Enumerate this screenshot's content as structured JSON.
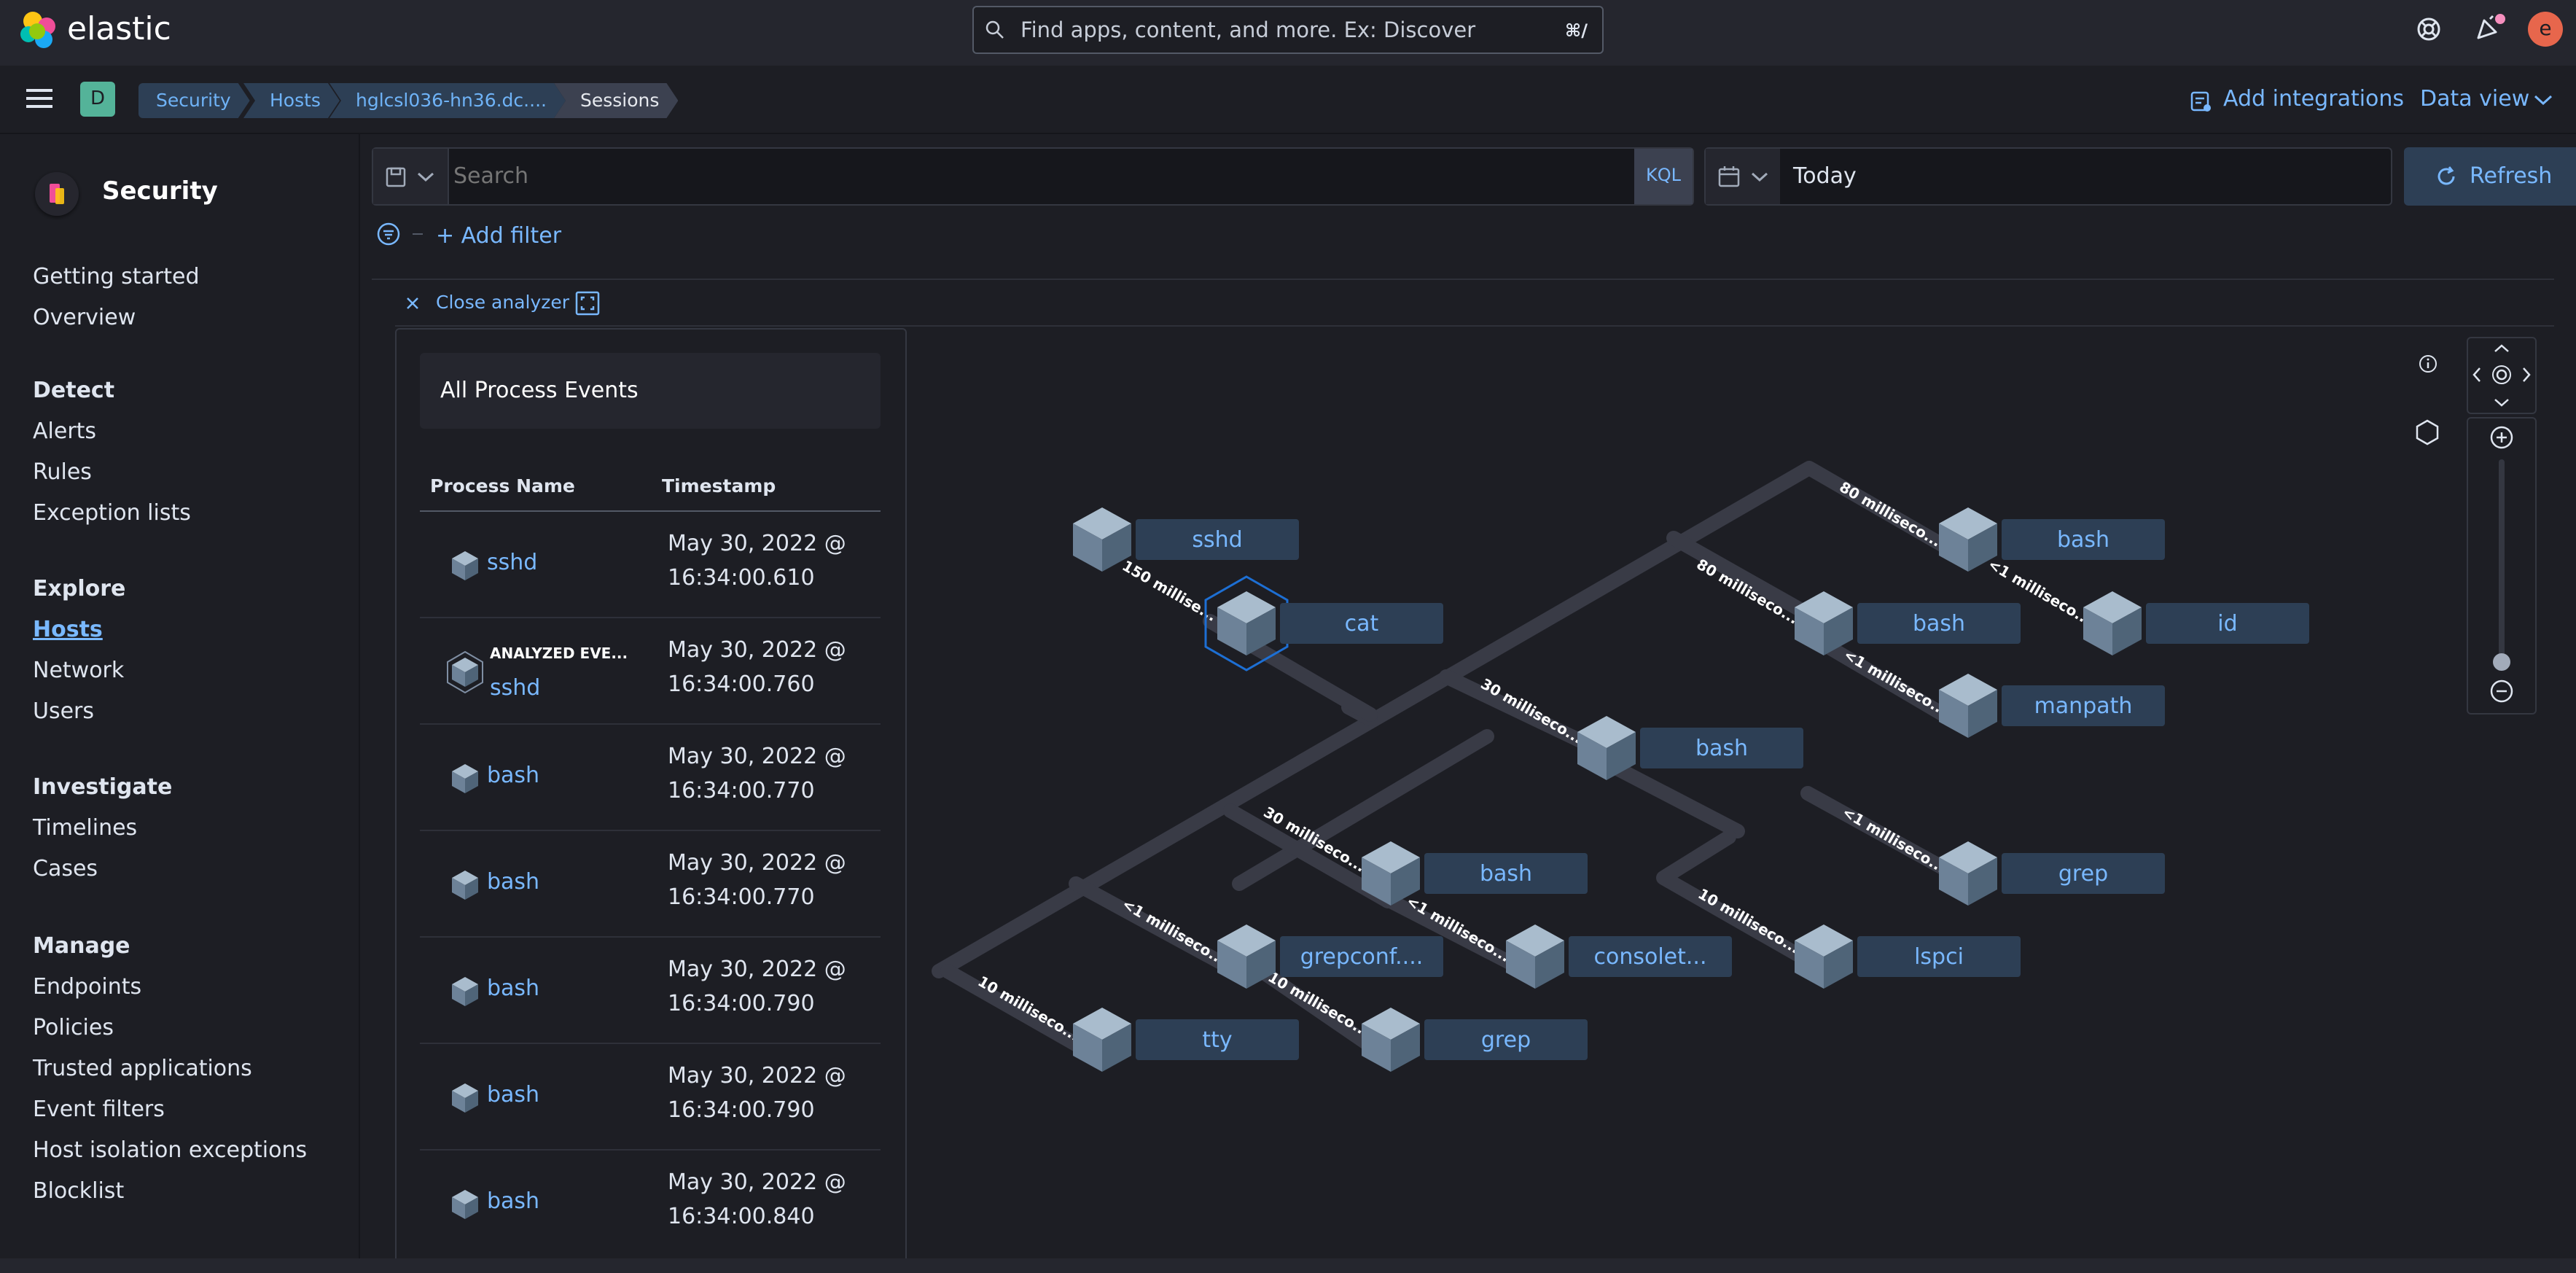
{
  "app": {
    "name": "elastic"
  },
  "header": {
    "search_placeholder": "Find apps, content, and more. Ex: Discover",
    "search_shortcut": "⌘/",
    "user_initial": "e"
  },
  "subheader": {
    "space_initial": "D",
    "breadcrumbs": [
      "Security",
      "Hosts",
      "hglcsl036-hn36.dc....",
      "Sessions"
    ],
    "add_integrations": "Add integrations",
    "data_view": "Data view"
  },
  "sidebar": {
    "title": "Security",
    "items": [
      "Getting started",
      "Overview"
    ],
    "sections": [
      {
        "heading": "Detect",
        "items": [
          "Alerts",
          "Rules",
          "Exception lists"
        ]
      },
      {
        "heading": "Explore",
        "items": [
          "Hosts",
          "Network",
          "Users"
        ]
      },
      {
        "heading": "Investigate",
        "items": [
          "Timelines",
          "Cases"
        ]
      },
      {
        "heading": "Manage",
        "items": [
          "Endpoints",
          "Policies",
          "Trusted applications",
          "Event filters",
          "Host isolation exceptions",
          "Blocklist"
        ]
      }
    ]
  },
  "query": {
    "search_placeholder": "Search",
    "language": "KQL",
    "date": "Today",
    "refresh": "Refresh",
    "add_filter": "+ Add filter"
  },
  "analyzer": {
    "close": "Close analyzer",
    "panel_title": "All Process Events",
    "columns": [
      "Process Name",
      "Timestamp"
    ],
    "analyzed_tag": "ANALYZED EVE...",
    "rows": [
      {
        "name": "sshd",
        "date": "May 30, 2022 @",
        "time": "16:34:00.610"
      },
      {
        "name": "sshd",
        "date": "May 30, 2022 @",
        "time": "16:34:00.760"
      },
      {
        "name": "bash",
        "date": "May 30, 2022 @",
        "time": "16:34:00.770"
      },
      {
        "name": "bash",
        "date": "May 30, 2022 @",
        "time": "16:34:00.770"
      },
      {
        "name": "bash",
        "date": "May 30, 2022 @",
        "time": "16:34:00.790"
      },
      {
        "name": "bash",
        "date": "May 30, 2022 @",
        "time": "16:34:00.790"
      },
      {
        "name": "bash",
        "date": "May 30, 2022 @",
        "time": "16:34:00.840"
      }
    ],
    "graph": {
      "nodes": [
        "sshd",
        "cat",
        "bash",
        "id",
        "bash",
        "manpath",
        "bash",
        "bash",
        "grep",
        "grepconf....",
        "consolet...",
        "lspci",
        "tty",
        "grep"
      ],
      "edges": [
        "150 millise...",
        "80 milliseco...",
        "<1 milliseco...",
        "80 milliseco...",
        "<1 milliseco...",
        "30 milliseco...",
        "30 milliseco...",
        "<1 milliseco...",
        "<1 milliseco...",
        "10 milliseco...",
        "<1 milliseco...",
        "10 milliseco...",
        "10 milliseco..."
      ]
    }
  },
  "colors": {
    "accent": "#79b8ff",
    "node_bg": "#2d3f55",
    "edge": "#393b46"
  }
}
